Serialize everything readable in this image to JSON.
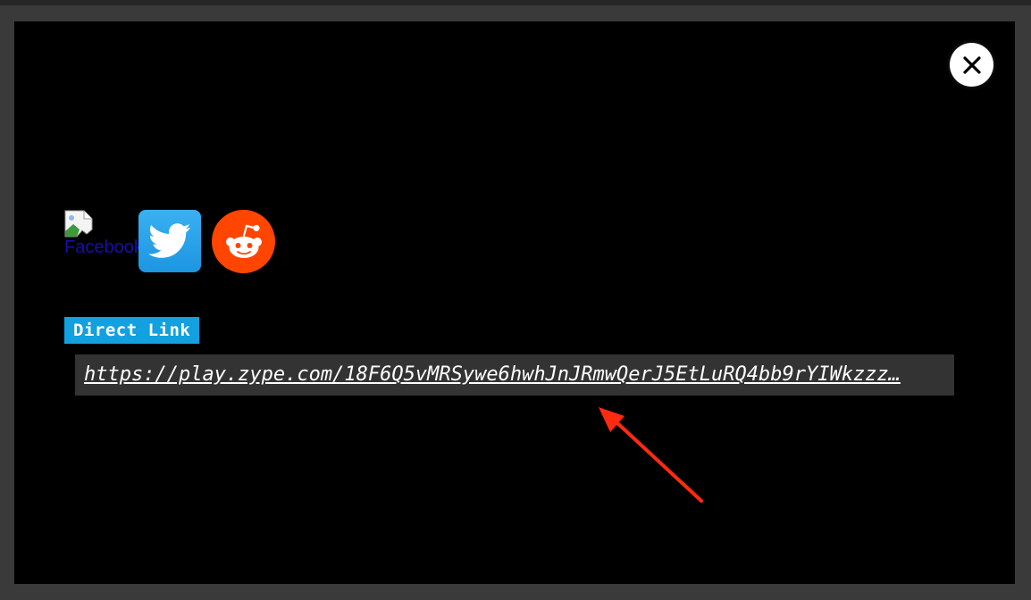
{
  "share_modal": {
    "close_label": "×",
    "facebook": {
      "alt_text": "Facebook",
      "icon": "broken-image-icon"
    },
    "twitter": {
      "icon": "twitter-bird-icon",
      "brand_color": "#1da1f2"
    },
    "reddit": {
      "icon": "reddit-alien-icon",
      "brand_color": "#ff4500"
    },
    "direct_link": {
      "label": "Direct Link",
      "url": "https://play.zype.com/18F6Q5vMRSywe6hwhJnJRmwQerJ5EtLuRQ4bb9rYIWkzzz…",
      "label_bg": "#12a0e0"
    }
  },
  "annotation": {
    "icon": "red-arrow-icon",
    "color": "#ff2a10"
  }
}
